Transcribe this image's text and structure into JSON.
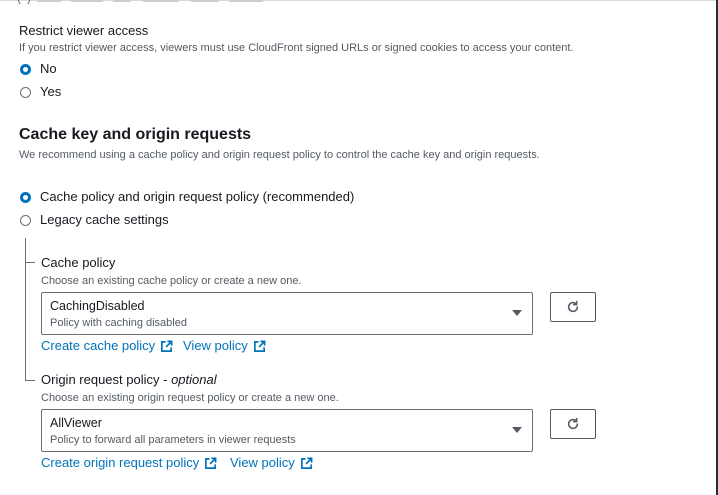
{
  "restrict": {
    "label": "Restrict viewer access",
    "description": "If you restrict viewer access, viewers must use CloudFront signed URLs or signed cookies to access your content.",
    "options": [
      {
        "label": "No",
        "selected": true
      },
      {
        "label": "Yes",
        "selected": false
      }
    ]
  },
  "cache_section": {
    "heading": "Cache key and origin requests",
    "description": "We recommend using a cache policy and origin request policy to control the cache key and origin requests.",
    "options": [
      {
        "label": "Cache policy and origin request policy (recommended)",
        "selected": true
      },
      {
        "label": "Legacy cache settings",
        "selected": false
      }
    ]
  },
  "cache_policy": {
    "label": "Cache policy",
    "description": "Choose an existing cache policy or create a new one.",
    "selected_value": "CachingDisabled",
    "selected_description": "Policy with caching disabled",
    "create_link": "Create cache policy",
    "view_link": "View policy"
  },
  "origin_policy": {
    "label": "Origin request policy - ",
    "label_optional": "optional",
    "description": "Choose an existing origin request policy or create a new one.",
    "selected_value": "AllViewer",
    "selected_description": "Policy to forward all parameters in viewer requests",
    "create_link": "Create origin request policy",
    "view_link": "View policy"
  },
  "colors": {
    "accent": "#0073bb",
    "text": "#16191f",
    "muted": "#545b64",
    "border": "#687078"
  }
}
